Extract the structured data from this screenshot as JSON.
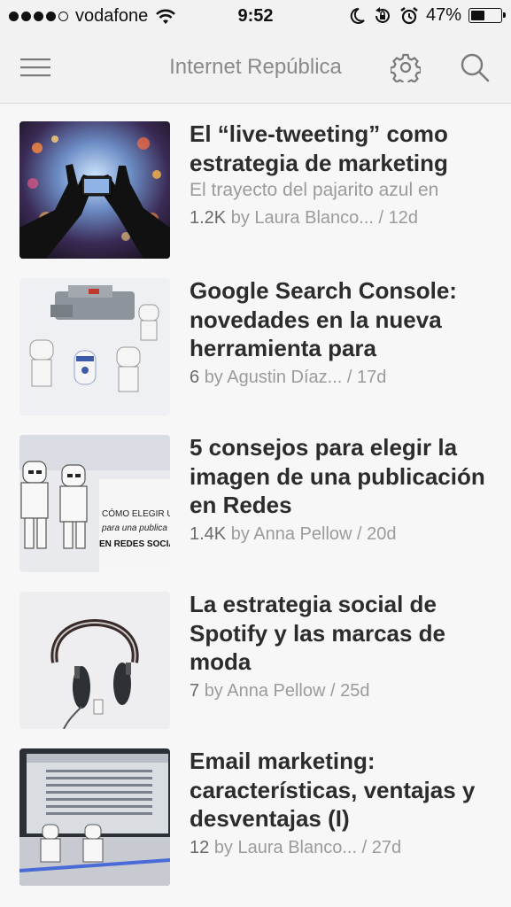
{
  "status_bar": {
    "carrier": "vodafone",
    "time": "9:52",
    "battery": "47%",
    "battery_level": 0.47
  },
  "nav": {
    "title": "Internet República",
    "menu_icon": "hamburger-menu-icon",
    "settings_icon": "gear-icon",
    "search_icon": "search-icon"
  },
  "articles": [
    {
      "title": "El “live-tweeting” como estrategia de marketing",
      "excerpt": "El trayecto del pajarito azul en",
      "count": "1.2K",
      "byline": "by Laura Blanco... / 12d",
      "thumb": "concert-crowd-phone"
    },
    {
      "title": "Google Search Console: novedades en la nueva herramienta para",
      "excerpt": "",
      "count": "6",
      "byline": "by Agustin Díaz... / 17d",
      "thumb": "lego-stormtroopers-r2d2"
    },
    {
      "title": "5 consejos para elegir la imagen de una publicación en Redes",
      "excerpt": "",
      "count": "1.4K",
      "byline": "by Anna Pellow / 20d",
      "thumb": "stormtroopers-sign",
      "thumb_text": [
        "CÓMO ELEGIR UNA IMA",
        "para una publica",
        "EN REDES SOCIA"
      ]
    },
    {
      "title": "La estrategia social de Spotify y las marcas de moda",
      "excerpt": "",
      "count": "7",
      "byline": "by Anna Pellow / 25d",
      "thumb": "headphones"
    },
    {
      "title": "Email marketing: características, ventajas y desventajas (I)",
      "excerpt": "",
      "count": "12",
      "byline": "by Laura Blanco... / 27d",
      "thumb": "laptop-stormtroopers"
    }
  ]
}
